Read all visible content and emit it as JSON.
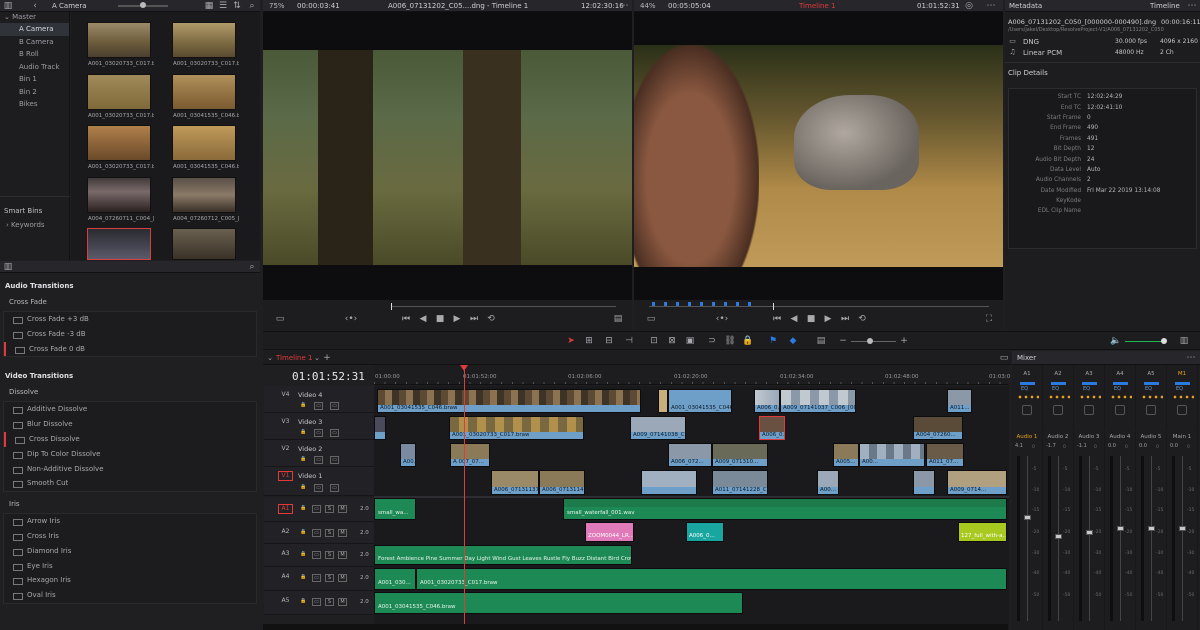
{
  "media_pool": {
    "bin_title": "A Camera",
    "master_label": "Master",
    "bins": [
      "A Camera",
      "B Camera",
      "B Roll",
      "Audio Track",
      "Bin 1",
      "Bin 2",
      "Bikes"
    ],
    "smart_bins_label": "Smart Bins",
    "smart_bin_items": [
      "Keywords"
    ],
    "clips": [
      "A001_03020733_C017.br...",
      "A001_03020733_C017.br...",
      "A001_03020733_C017.br...",
      "A001_03041535_C046.br...",
      "A001_03020733_C017.br...",
      "A001_03041535_C046.br...",
      "A001_03041535_C046.br...",
      "A001_03041535_C046.br...",
      "A004_07260711_C004_[...",
      "A004_07260712_C005_[...",
      "",
      ""
    ]
  },
  "effects": {
    "audio_transitions": "Audio Transitions",
    "cross_fade": "Cross Fade",
    "cross_fade_items": [
      "Cross Fade +3 dB",
      "Cross Fade -3 dB",
      "Cross Fade 0 dB"
    ],
    "video_transitions": "Video Transitions",
    "dissolve": "Dissolve",
    "dissolve_items": [
      "Additive Dissolve",
      "Blur Dissolve",
      "Cross Dissolve",
      "Dip To Color Dissolve",
      "Non-Additive Dissolve",
      "Smooth Cut"
    ],
    "iris": "Iris",
    "iris_items": [
      "Arrow Iris",
      "Cross Iris",
      "Diamond Iris",
      "Eye Iris",
      "Hexagon Iris",
      "Oval Iris"
    ]
  },
  "source_viewer": {
    "zoom": "75%",
    "timecode": "00:00:03:41",
    "clip_name": "A006_07131202_C05....dng - Timeline 1",
    "duration_tc": "12:02:30:16"
  },
  "timeline_viewer": {
    "zoom": "44%",
    "timecode": "00:05:05:04",
    "timeline_name": "Timeline 1",
    "duration_tc": "01:01:52:31"
  },
  "metadata": {
    "title": "Metadata",
    "mode": "Timeline",
    "file_name": "A006_07131202_C050_[000000-000490].dng",
    "file_duration": "00:00:16:11",
    "file_path": "/Users/jakel/Desktop/ResolveProject-V1/A006_07131202_C050",
    "codec": "DNG",
    "fps": "30.000 fps",
    "resolution": "4096 x 2160",
    "audio_codec": "Linear PCM",
    "sample_rate": "48000 Hz",
    "channels": "2 Ch",
    "details_title": "Clip Details",
    "props": [
      [
        "Start TC",
        "12:02:24:29"
      ],
      [
        "End TC",
        "12:02:41:10"
      ],
      [
        "Start Frame",
        "0"
      ],
      [
        "End Frame",
        "490"
      ],
      [
        "Frames",
        "491"
      ],
      [
        "Bit Depth",
        "12"
      ],
      [
        "Audio Bit Depth",
        "24"
      ],
      [
        "Data Level",
        "Auto"
      ],
      [
        "Audio Channels",
        "2"
      ],
      [
        "Date Modified",
        "Fri Mar 22 2019 13:14:08"
      ],
      [
        "KeyKode",
        ""
      ],
      [
        "EDL Clip Name",
        ""
      ]
    ]
  },
  "timeline": {
    "tab": "Timeline 1",
    "timecode": "01:01:52:31",
    "ruler": [
      "01:00:00",
      "01:01:52:00",
      "01:02:06:00",
      "01:02:20:00",
      "01:02:34:00",
      "01:02:48:00",
      "01:03:0"
    ],
    "video_tracks": [
      {
        "id": "V4",
        "name": "Video 4"
      },
      {
        "id": "V3",
        "name": "Video 3"
      },
      {
        "id": "V2",
        "name": "Video 2"
      },
      {
        "id": "V1",
        "name": "Video 1"
      }
    ],
    "audio_tracks": [
      {
        "id": "A1",
        "level": "2.0"
      },
      {
        "id": "A2",
        "level": "2.0"
      },
      {
        "id": "A3",
        "level": "2.0"
      },
      {
        "id": "A4",
        "level": "2.0"
      },
      {
        "id": "A5",
        "level": "2.0"
      }
    ],
    "clip_labels": {
      "v4a": "A001_03041535_C046.braw",
      "v4b": "A001_03041535_C046.braw",
      "v4c": "A006_0...",
      "v4d": "A009_07141037_C006_[0000...",
      "v4e": "A011...",
      "v3a": "A001_03020733_C017.braw",
      "v3b": "A009_07141038_C0...",
      "v3c": "A006_0...",
      "v3d": "A004_07260...",
      "v2a": "A00...",
      "v2b": "A 007_07...",
      "v2c": "A006_072...",
      "v2d": "A009_071310...",
      "v2e": "A005...",
      "v2f": "A00...",
      "v2g": "A011_07...",
      "v1a": "A006_07131137...",
      "v1b": "A006_0713114...",
      "v1c": "A011_07141228_C0...",
      "v1d": "A00...",
      "v1e": "A009_0714...",
      "a1a": "small_wa...",
      "a1b": "small_waterfall_001.wav",
      "a2a": "ZOOM0044_LR....",
      "a2b": "A006_0...",
      "a2c": "127_full_with-a...",
      "a3a": "Forest Ambience Pine Summer Day Light Wind Gust Leaves Rustle Fly Buzz Distant Bird Crow Ca...",
      "a4a": "A001_030...",
      "a4b": "A001_03020733_C017.braw",
      "a5a": "A001_03041535_C046.braw"
    }
  },
  "mixer": {
    "title": "Mixer",
    "channels": [
      "A1",
      "A2",
      "A3",
      "A4",
      "A5",
      "M1"
    ],
    "strips": [
      "Audio 1",
      "Audio 2",
      "Audio 3",
      "Audio 4",
      "Audio 5",
      "Main 1"
    ],
    "levels": [
      "4.1",
      "-1.7",
      "-1.1",
      "0.0",
      "0.0",
      "0.0"
    ],
    "eq": "EQ",
    "scale": [
      "0",
      "-5",
      "-10",
      "-15",
      "-20",
      "-30",
      "-40",
      "-50"
    ]
  },
  "colors": {
    "accent": "#e03a3a",
    "video_clip": "#6e9fc8",
    "audio_clip": "#1d8a55",
    "pink_clip": "#e07ab8",
    "teal_clip": "#1aa6a0",
    "lime_clip": "#a8c920"
  }
}
